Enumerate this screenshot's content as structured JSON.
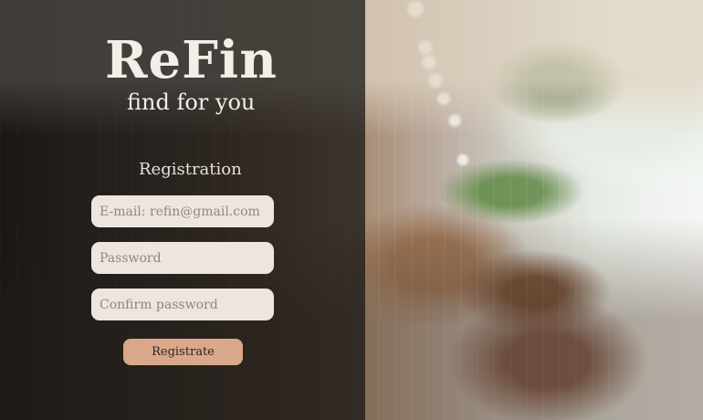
{
  "brand": {
    "name": "ReFin",
    "tagline": "find for you"
  },
  "form": {
    "title": "Registration",
    "email_placeholder": "E-mail: refin@gmail.com",
    "password_placeholder": "Password",
    "confirm_password_placeholder": "Confirm password",
    "submit_label": "Registrate"
  },
  "colors": {
    "panel_overlay": "#121212",
    "input_background": "#ece6df",
    "button_background": "#d9a88b",
    "text_light": "#f3eee8",
    "placeholder_text": "#8f8882"
  }
}
